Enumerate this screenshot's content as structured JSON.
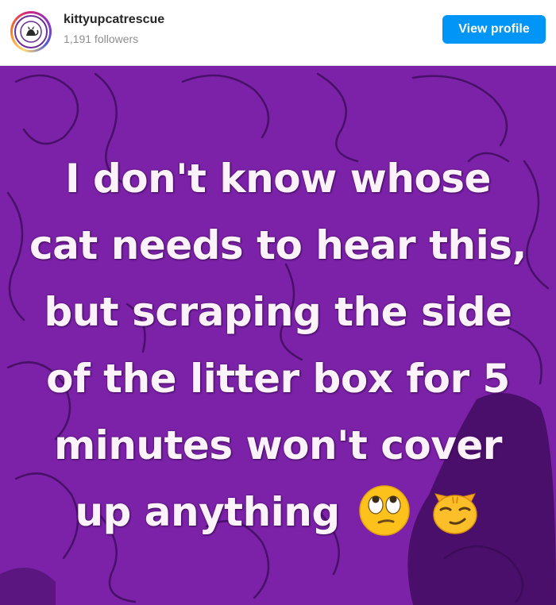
{
  "header": {
    "username": "kittyupcatrescue",
    "followers": "1,191 followers",
    "view_profile_label": "View profile",
    "avatar_icon": "cat-logo-icon"
  },
  "post": {
    "background_color": "#7c22a8",
    "lines": [
      "I don't know whose",
      "cat needs to hear this,",
      "but scraping the side",
      "of the litter box for 5",
      "minutes won't cover",
      "up anything"
    ],
    "emojis": [
      "eye-roll-emoji-icon",
      "smirking-cat-emoji-icon"
    ]
  }
}
